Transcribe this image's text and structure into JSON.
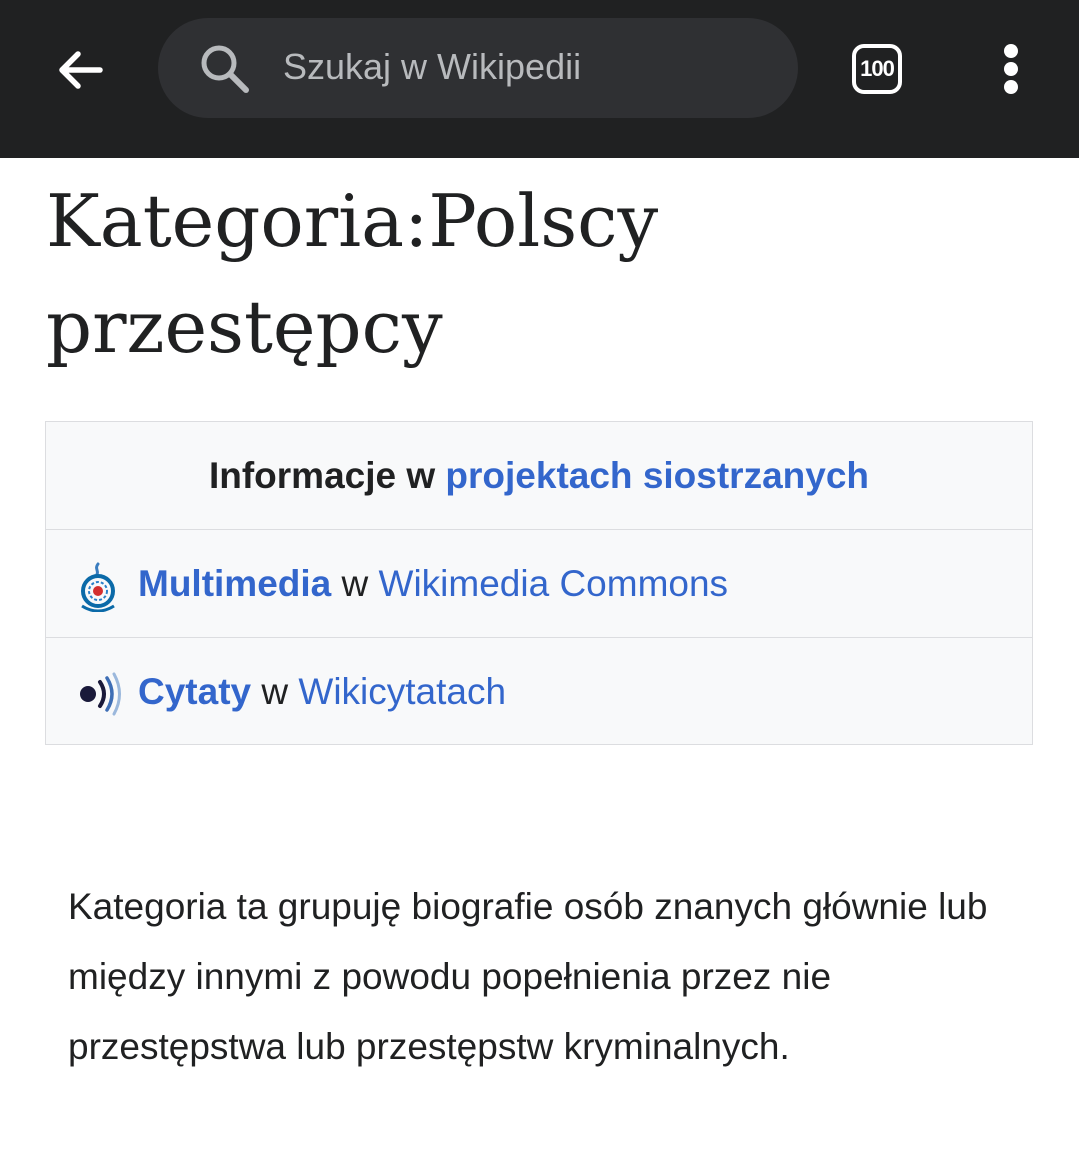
{
  "topbar": {
    "search_placeholder": "Szukaj w Wikipedii",
    "tab_count": "100",
    "background": "#202122"
  },
  "page": {
    "title": "Kategoria:Polscy przestępcy"
  },
  "sister_projects": {
    "header_prefix": "Informacje w ",
    "header_link": "projektach siostrzanych",
    "items": [
      {
        "icon": "wikimedia-commons-icon",
        "label": "Multimedia",
        "connector": " w ",
        "project": "Wikimedia Commons"
      },
      {
        "icon": "wikiquote-icon",
        "label": "Cytaty",
        "connector": " w ",
        "project": "Wikicytatach"
      }
    ]
  },
  "description": "Kategoria ta grupuję biografie osób znanych głównie lub między innymi z powodu popełnienia przez nie przestępstwa lub przestępstw kryminalnych.",
  "colors": {
    "link": "#3366cc",
    "text": "#202122",
    "box_bg": "#f8f9fa",
    "border": "#dcdde0"
  }
}
